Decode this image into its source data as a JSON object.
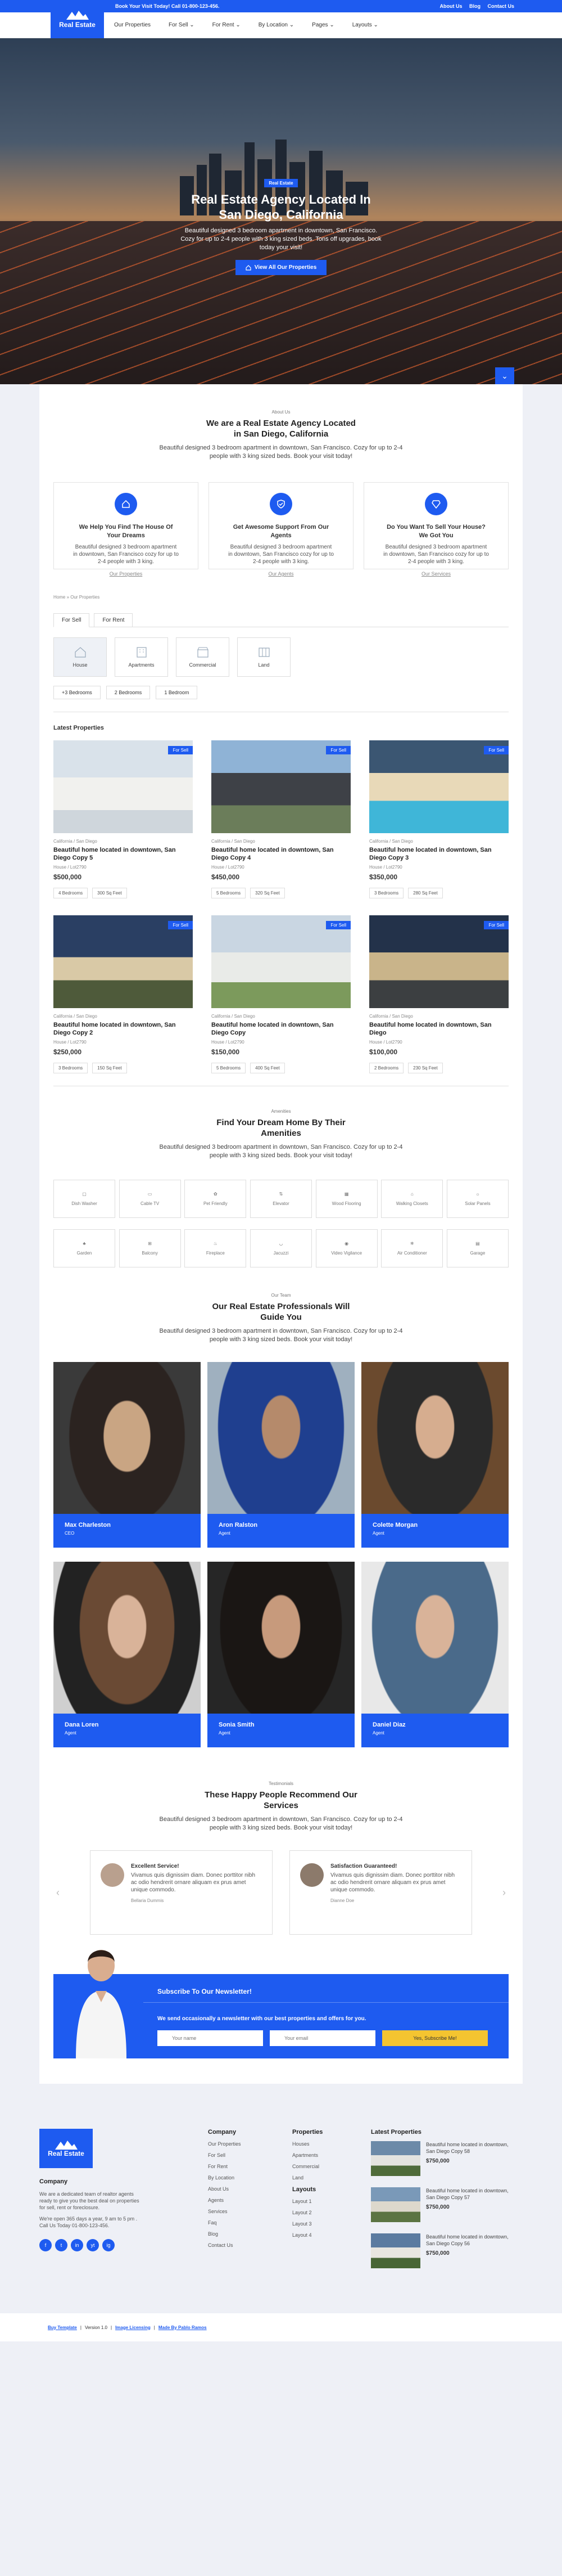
{
  "topbar": {
    "call": "Book Your Visit Today! Call 01-800-123-456.",
    "about": "About Us",
    "blog": "Blog",
    "contact": "Contact Us"
  },
  "logo": {
    "text": "Real Estate"
  },
  "menu": [
    "Our Properties",
    "For Sell",
    "For Rent",
    "By Location",
    "Pages",
    "Layouts"
  ],
  "hero": {
    "badge": "Real Estate",
    "title": "Real Estate Agency Located In San Diego, California",
    "text": "Beautiful designed 3 bedroom apartment in downtown, San Francisco. Cozy for up to 2-4 people with 3 king sized beds. Tons off upgrades, book today your visit!",
    "button": "View All Our Properties"
  },
  "about": {
    "kicker": "About Us",
    "title": "We are a Real Estate Agency Located in San Diego, California",
    "text": "Beautiful designed 3 bedroom apartment in downtown, San Francisco. Cozy for up to 2-4 people with 3 king sized beds. Book your visit today!"
  },
  "features": [
    {
      "title": "We Help You Find The House Of Your Dreams",
      "text": "Beautiful designed 3 bedroom apartment in downtown, San Francisco cozy for up to 2-4 people with 3 king.",
      "link": "Our Properties"
    },
    {
      "title": "Get Awesome Support From Our Agents",
      "text": "Beautiful designed 3 bedroom apartment in downtown, San Francisco cozy for up to 2-4 people with 3 king.",
      "link": "Our Agents"
    },
    {
      "title": "Do You Want To Sell Your House? We Got You",
      "text": "Beautiful designed 3 bedroom apartment in downtown, San Francisco cozy for up to 2-4 people with 3 king.",
      "link": "Our Services"
    }
  ],
  "breadcrumb": "Home » Our Properties",
  "tabs": [
    "For Sell",
    "For Rent"
  ],
  "types": [
    "House",
    "Apartments",
    "Commercial",
    "Land"
  ],
  "beds": [
    "+3 Bedrooms",
    "2 Bedrooms",
    "1 Bedroom"
  ],
  "latest": "Latest Properties",
  "properties": [
    {
      "sale": "For Sell",
      "loc": "California / San Diego",
      "title": "Beautiful home located in downtown, San Diego Copy 5",
      "meta": "House / Lot2790",
      "price": "$500,000",
      "beds": "4 Bedrooms",
      "size": "300 Sq Feet"
    },
    {
      "sale": "For Sell",
      "loc": "California / San Diego",
      "title": "Beautiful home located in downtown, San Diego Copy 4",
      "meta": "House / Lot2790",
      "price": "$450,000",
      "beds": "5 Bedrooms",
      "size": "320 Sq Feet"
    },
    {
      "sale": "For Sell",
      "loc": "California / San Diego",
      "title": "Beautiful home located in downtown, San Diego Copy 3",
      "meta": "House / Lot2790",
      "price": "$350,000",
      "beds": "3 Bedrooms",
      "size": "280 Sq Feet"
    },
    {
      "sale": "For Sell",
      "loc": "California / San Diego",
      "title": "Beautiful home located in downtown, San Diego Copy 2",
      "meta": "House / Lot2790",
      "price": "$250,000",
      "beds": "3 Bedrooms",
      "size": "150 Sq Feet"
    },
    {
      "sale": "For Sell",
      "loc": "California / San Diego",
      "title": "Beautiful home located in downtown, San Diego Copy",
      "meta": "House / Lot2790",
      "price": "$150,000",
      "beds": "5 Bedrooms",
      "size": "400 Sq Feet"
    },
    {
      "sale": "For Sell",
      "loc": "California / San Diego",
      "title": "Beautiful home located in downtown, San Diego",
      "meta": "House / Lot2790",
      "price": "$100,000",
      "beds": "2 Bedrooms",
      "size": "230 Sq Feet"
    }
  ],
  "amenities": {
    "kicker": "Amenities",
    "title": "Find Your Dream Home By Their Amenities",
    "text": "Beautiful designed 3 bedroom apartment in downtown, San Francisco. Cozy for up to 2-4 people with 3 king sized beds. Book your visit today!",
    "items": [
      "Dish Washer",
      "Cable TV",
      "Pet Friendly",
      "Elevator",
      "Wood Flooring",
      "Walking Closets",
      "Solar Panels",
      "Garden",
      "Balcony",
      "Fireplace",
      "Jacuzzi",
      "Video Vigilance",
      "Air Conditioner",
      "Garage"
    ]
  },
  "team": {
    "kicker": "Our Team",
    "title": "Our Real Estate Professionals Will Guide You",
    "text": "Beautiful designed 3 bedroom apartment in downtown, San Francisco. Cozy for up to 2-4 people with 3 king sized beds. Book your visit today!",
    "members": [
      {
        "name": "Max Charleston",
        "role": "CEO"
      },
      {
        "name": "Aron Ralston",
        "role": "Agent"
      },
      {
        "name": "Colette Morgan",
        "role": "Agent"
      },
      {
        "name": "Dana Loren",
        "role": "Agent"
      },
      {
        "name": "Sonia Smith",
        "role": "Agent"
      },
      {
        "name": "Daniel Diaz",
        "role": "Agent"
      }
    ]
  },
  "testimonials": {
    "kicker": "Testimonials",
    "title": "These Happy People Recommend Our Services",
    "text": "Beautiful designed 3 bedroom apartment in downtown, San Francisco. Cozy for up to 2-4 people with 3 king sized beds. Book your visit today!",
    "items": [
      {
        "title": "Excellent Service!",
        "text": "Vivamus quis dignissim diam. Donec porttitor nibh ac odio hendrerit ornare aliquam ex prus amet unique commodo.",
        "who": "Bellaria Dummis"
      },
      {
        "title": "Satisfaction Guaranteed!",
        "text": "Vivamus quis dignissim diam. Donec porttitor nibh ac odio hendrerit ornare aliquam ex prus amet unique commodo.",
        "who": "Dianne Doe"
      }
    ]
  },
  "newsletter": {
    "title": "Subscribe To Our Newsletter!",
    "sub": "We send occasionally a newsletter with our best properties and offers for you.",
    "name_ph": "Your name",
    "email_ph": "Your email",
    "button": "Yes, Subscribe Me!"
  },
  "footer": {
    "logo": "Real Estate",
    "company_title": "Company",
    "company_text": "We are a dedicated team of realtor agents ready to give you the best deal on properties for sell, rent or foreclosure.",
    "company_hours": "We're open 365 days a year, 9 am to 5 pm . Call Us Today 01-800-123-456.",
    "socials": [
      "f",
      "t",
      "in",
      "yt",
      "ig"
    ],
    "col1_title": "Company",
    "col1": [
      "Our Properties",
      "For Sell",
      "For Rent",
      "By Location",
      "About Us",
      "Agents",
      "Services",
      "Faq",
      "Blog",
      "Contact Us"
    ],
    "col2_title": "Properties",
    "col2": [
      "Houses",
      "Apartments",
      "Commercial",
      "Land"
    ],
    "col3_title": "Layouts",
    "col3": [
      "Layout 1",
      "Layout 2",
      "Layout 3",
      "Layout 4"
    ],
    "latest_title": "Latest Properties",
    "latest": [
      {
        "title": "Beautiful home located in downtown, San Diego Copy 58",
        "price": "$750,000"
      },
      {
        "title": "Beautiful home located in downtown, San Diego Copy 57",
        "price": "$750,000"
      },
      {
        "title": "Beautiful home located in downtown, San Diego Copy 56",
        "price": "$750,000"
      }
    ]
  },
  "bottom": {
    "template": "Buy Template",
    "version": "Version 1.0",
    "licensing": "Image Licensing",
    "made": "Made By Pablo Ramos"
  }
}
